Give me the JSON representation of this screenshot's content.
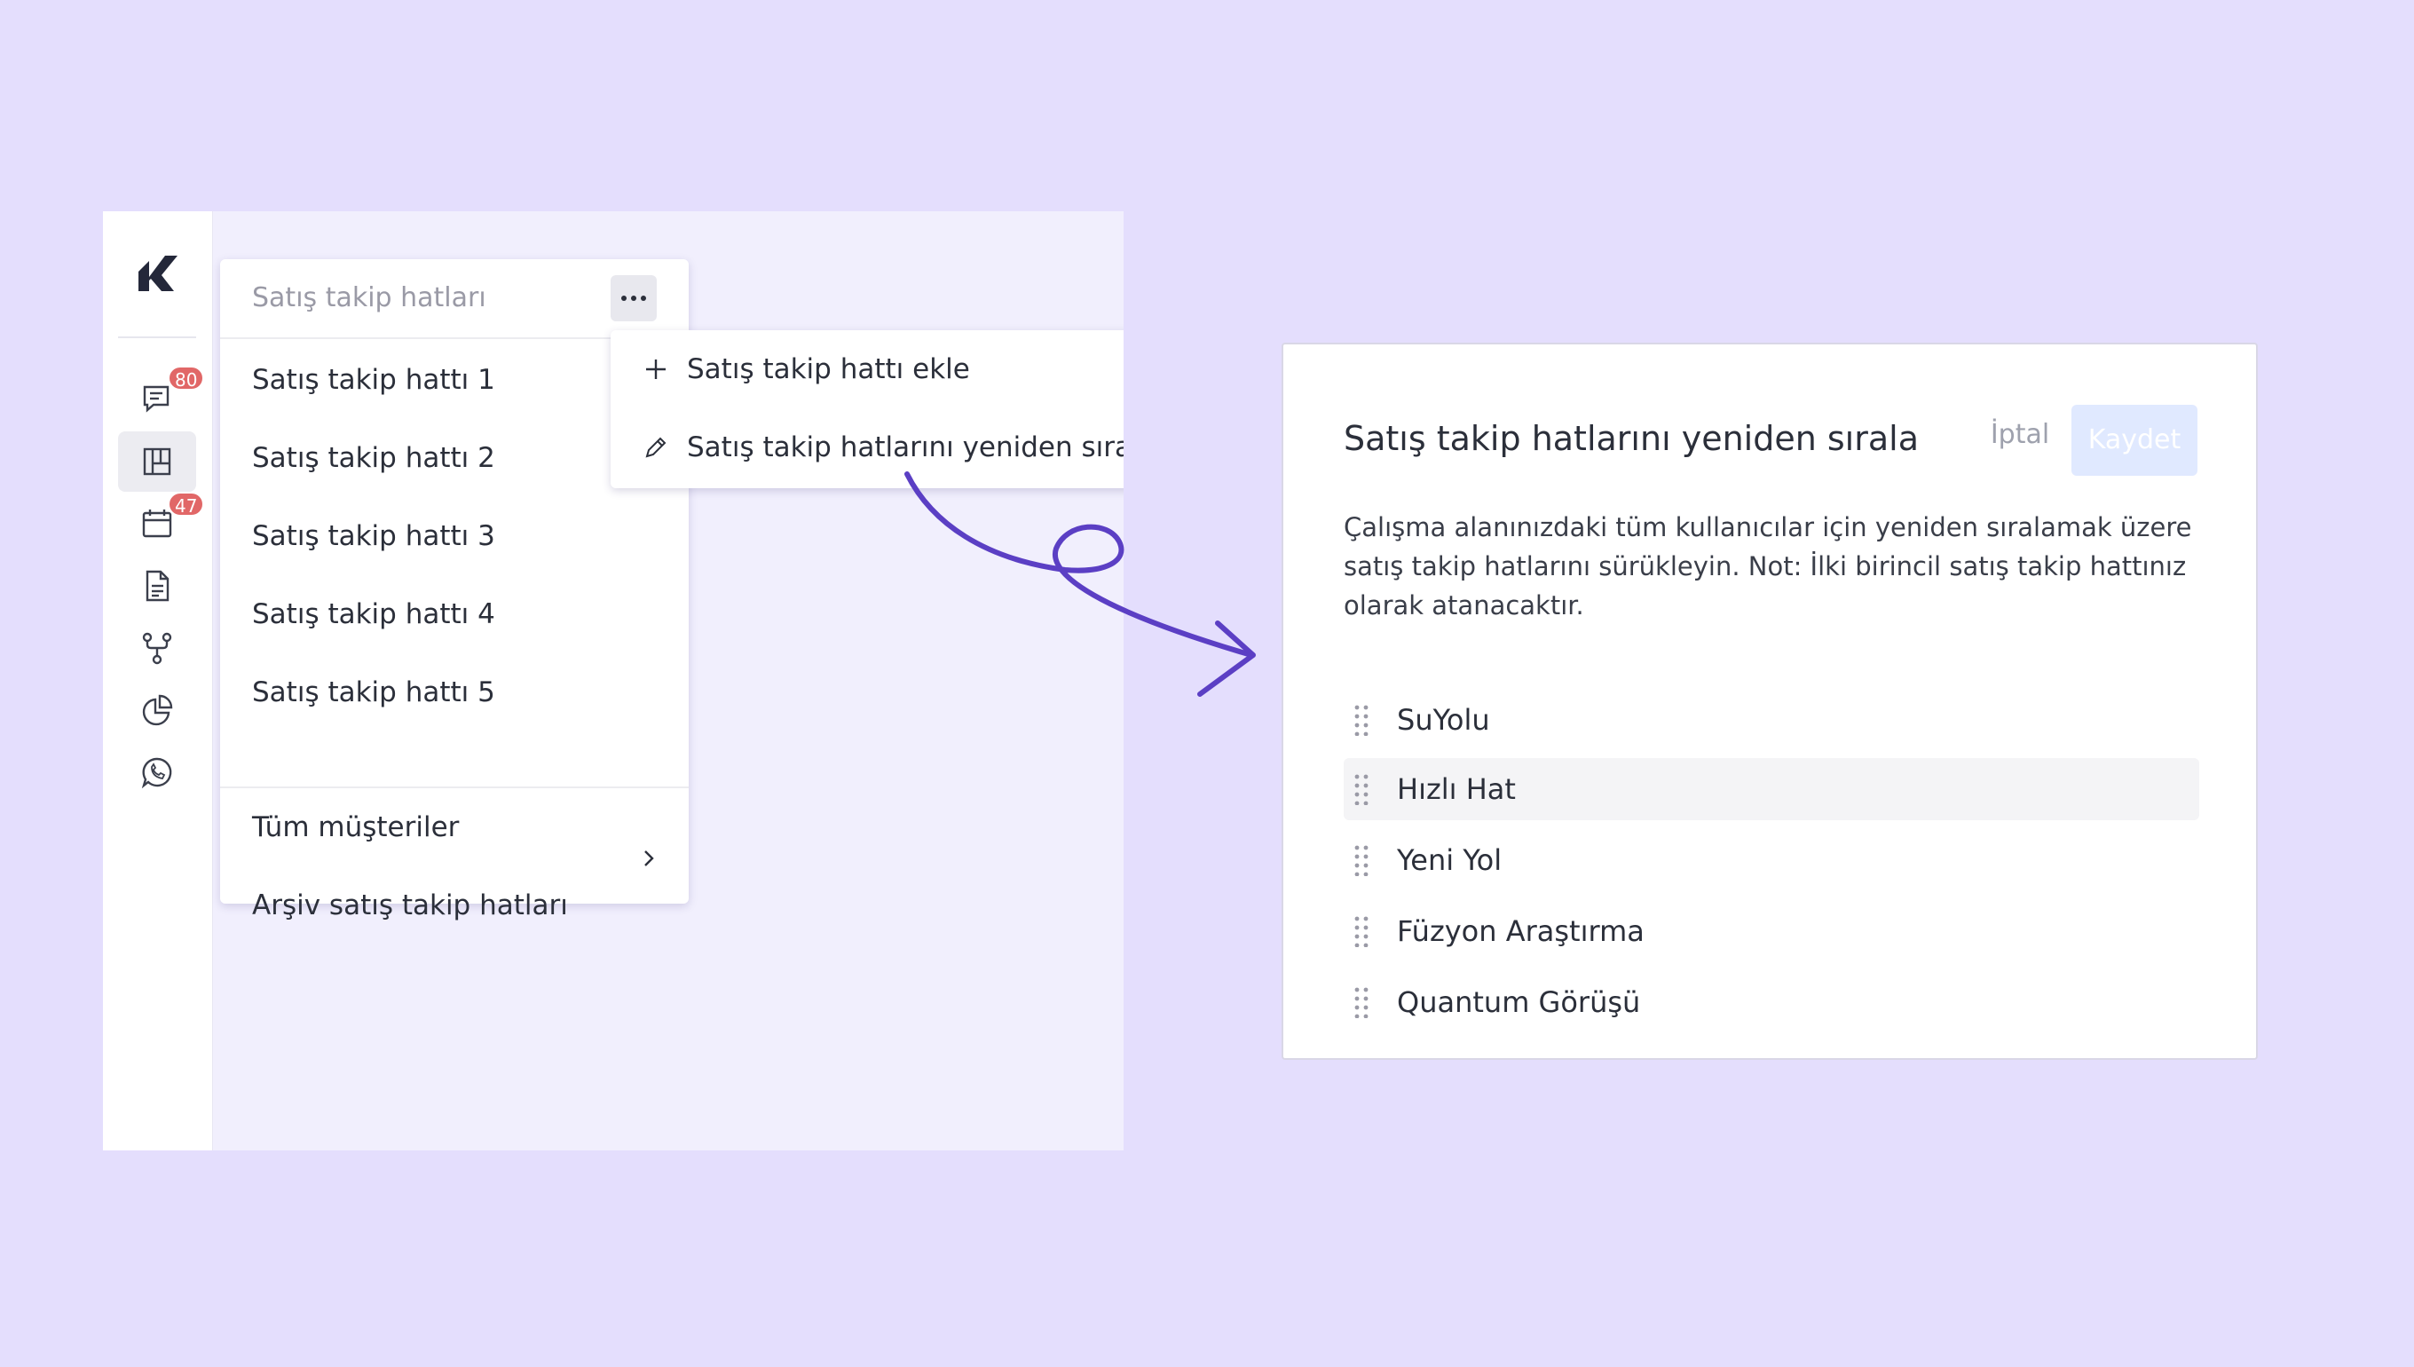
{
  "sidebar": {
    "logo": "K",
    "items": [
      {
        "icon": "chat-icon",
        "badge": "80"
      },
      {
        "icon": "kanban-icon",
        "active": true
      },
      {
        "icon": "calendar-icon",
        "badge": "47"
      },
      {
        "icon": "document-icon"
      },
      {
        "icon": "workflow-icon"
      },
      {
        "icon": "pie-chart-icon"
      },
      {
        "icon": "whatsapp-icon"
      }
    ]
  },
  "pipelines_menu": {
    "search_placeholder": "Satış takip hatları",
    "more_label": "···",
    "pipelines": [
      "Satış takip hattı 1",
      "Satış takip hattı 2",
      "Satış takip hattı 3",
      "Satış takip hattı 4",
      "Satış takip hattı 5"
    ],
    "all_customers": "Tüm müşteriler",
    "archive": "Arşiv satış takip hatları"
  },
  "context_menu": {
    "add": "Satış takip hattı ekle",
    "reorder": "Satış takip hatlarını yeniden sırala"
  },
  "dialog": {
    "title": "Satış takip hatlarını yeniden sırala",
    "cancel": "İptal",
    "save": "Kaydet",
    "description": "Çalışma alanınızdaki tüm kullanıcılar için yeniden sıralamak üzere satış takip hatlarını sürükleyin. Not: İlki birincil satış takip hattınız olarak atanacaktır.",
    "rows": [
      "SuYolu",
      "Hızlı Hat",
      "Yeni Yol",
      "Füzyon Araştırma",
      "Quantum Görüşü"
    ]
  },
  "colors": {
    "background": "#e4defd",
    "accent": "#5b3fc4",
    "badge": "#e16767",
    "save_disabled": "#e0e9ff"
  }
}
